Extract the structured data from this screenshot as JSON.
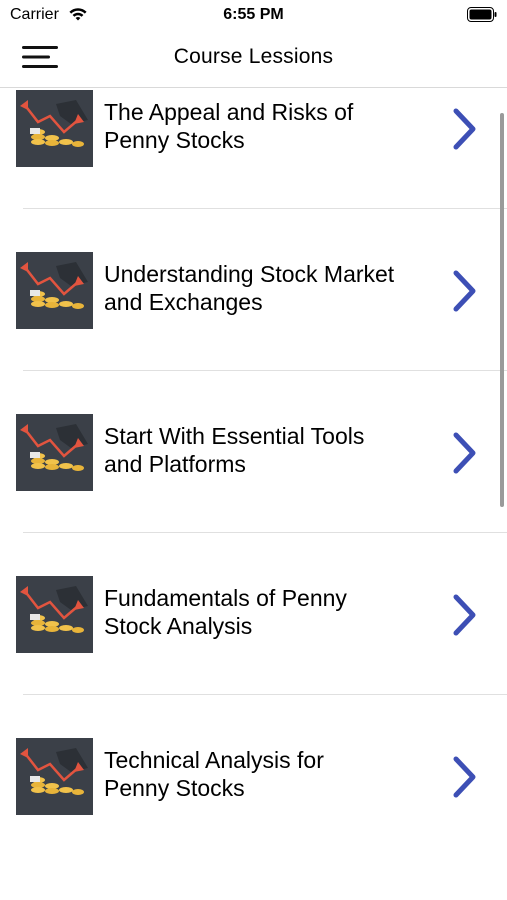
{
  "status": {
    "carrier": "Carrier",
    "time": "6:55 PM"
  },
  "nav": {
    "title": "Course Lessions",
    "menu_icon": "hamburger-menu-icon"
  },
  "lessons": [
    {
      "title_line1": "The Appeal and Risks of",
      "title_line2": "Penny Stocks"
    },
    {
      "title_line1": "Understanding Stock Market",
      "title_line2": "and Exchanges"
    },
    {
      "title_line1": "Start With Essential Tools",
      "title_line2": "and Platforms"
    },
    {
      "title_line1": "Fundamentals of Penny",
      "title_line2": "Stock Analysis"
    },
    {
      "title_line1": "Technical Analysis for",
      "title_line2": "Penny Stocks"
    }
  ],
  "colors": {
    "chevron": "#3d4fb5",
    "thumb_bg": "#3b4048",
    "divider": "#e0e0e0"
  }
}
